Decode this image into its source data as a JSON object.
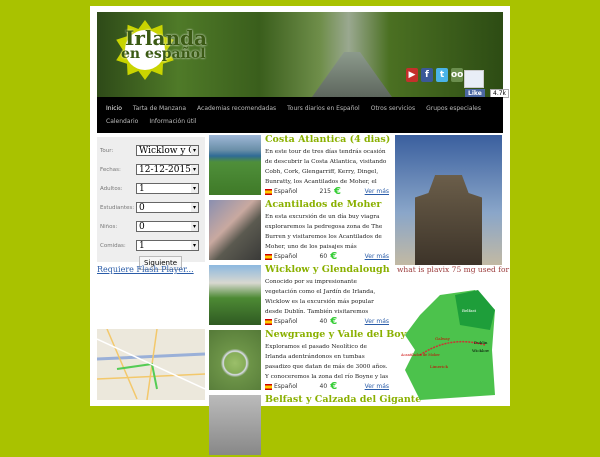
{
  "header": {
    "logo_line1": "Irlanda",
    "logo_line2": "en español",
    "like_label": "Like",
    "like_count": "4.7k",
    "social": [
      {
        "icon": "youtube-icon",
        "color": "#c4302b",
        "glyph": "▶"
      },
      {
        "icon": "facebook-icon",
        "color": "#3b5998",
        "glyph": "f"
      },
      {
        "icon": "twitter-icon",
        "color": "#4ab3e8",
        "glyph": "t"
      },
      {
        "icon": "tripadvisor-icon",
        "color": "#6b8e4e",
        "glyph": "oo"
      }
    ]
  },
  "nav": [
    "Inicio",
    "Tarta de Manzana",
    "Academias recomendadas",
    "Tours diarios en Español",
    "Otros servicios",
    "Grupos especiales",
    "Calendario",
    "Información útil"
  ],
  "form": {
    "fields": [
      {
        "label": "Tour:",
        "value": "Wicklow y Glendalough"
      },
      {
        "label": "Fechas:",
        "value": "12-12-2015"
      },
      {
        "label": "Adultos:",
        "value": "1"
      },
      {
        "label": "Estudiantes:",
        "value": "0"
      },
      {
        "label": "Niños:",
        "value": "0"
      },
      {
        "label": "Comidas:",
        "value": "1"
      }
    ],
    "submit": "Siguiente"
  },
  "flash_link": "Requiere Flash Player...",
  "tours": [
    {
      "title": "Costa Atlantica (4 dias)",
      "desc": "En este tour de tres días tendrás ocasión de descubrir la Costa Atlantica, visitando Cobh, Cork, Glengarriff, Kerry, Dingel, Bunratty, los Acantilados de Moher, el Burren y Galway.",
      "lang": "Español",
      "price": "215",
      "more": "Ver más"
    },
    {
      "title": "Acantilados de Moher",
      "desc": "En esta excursión de un día buy viagra exploraremos la pedregosa zona de The Burren y visitaremos los Acantilados de Moher, uno de los paisajes más impresionantes de Irlanda.",
      "lang": "Español",
      "price": "60",
      "more": "Ver más"
    },
    {
      "title": "Wicklow y Glendalough",
      "desc": "Conocido por su impresionante vegetación como el Jardín de Irlanda, Wicklow es la excursión más popular desde Dublín. También visitaremos Powerscourt y Glendalough.",
      "lang": "Español",
      "price": "40",
      "more": "Ver más"
    },
    {
      "title": "Newgrange y Valle del Boyne",
      "desc": "Exploramos el pasado Neolítico de Irlanda adentrándonos en tumbas pasadizo que datan de más de 3000 años. Y conoceremos la zona del río Boyne y las batallas que allí tuvieron lugar.",
      "lang": "Español",
      "price": "40",
      "more": "Ver más"
    },
    {
      "title": "Belfast y Calzada del Gigante",
      "desc": "",
      "lang": "",
      "price": "",
      "more": ""
    }
  ],
  "sidebar_caption": "what is plavix 75 mg used for",
  "map_labels": [
    "Belfast",
    "Dublin",
    "Galway",
    "Acantilados de Moher",
    "Limerick",
    "Wicklow"
  ]
}
